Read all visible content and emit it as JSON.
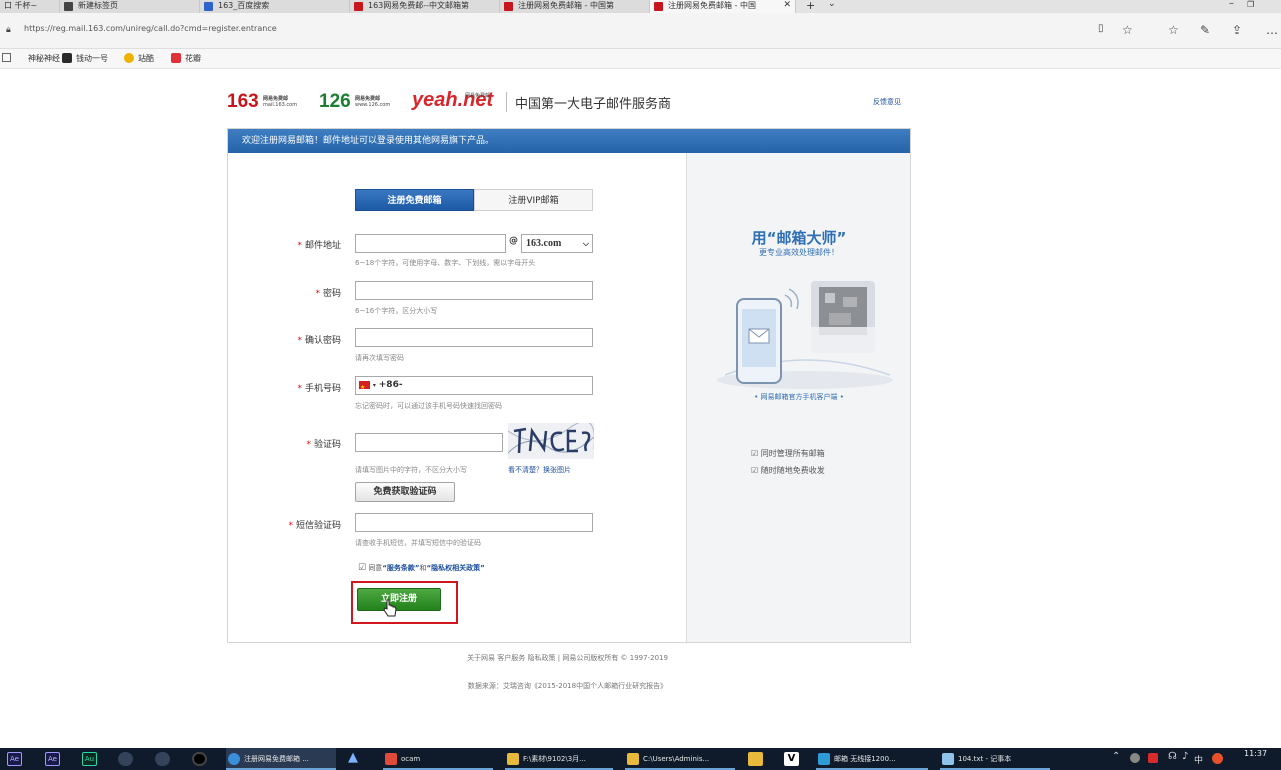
{
  "browser": {
    "tabs": [
      {
        "label": "口 千杯~",
        "active": false
      },
      {
        "label": "新建标签页",
        "active": false
      },
      {
        "label": "163_百度搜索",
        "active": false
      },
      {
        "label": "163网易免费邮--中文邮箱第",
        "active": false
      },
      {
        "label": "注册网易免费邮箱 - 中国第",
        "active": false
      },
      {
        "label": "注册网易免费邮箱 - 中国",
        "active": true
      }
    ],
    "url": "https://reg.mail.163.com/unireg/call.do?cmd=register.entrance",
    "bookmarks": [
      "神秘神经",
      "钱动一号",
      "站酷",
      "花瓣"
    ]
  },
  "header": {
    "logo_163": "163",
    "logo_163_sub_top": "网易免费邮",
    "logo_163_sub_bottom": "mail.163.com",
    "logo_126": "126",
    "logo_126_sub_top": "网易免费邮",
    "logo_126_sub_bottom": "www.126.com",
    "logo_yeah": "yeah.net",
    "logo_yeah_sub": "网易免费邮",
    "slogan": "中国第一大电子邮件服务商",
    "feedback_link": "反馈意见"
  },
  "banner": "欢迎注册网易邮箱！邮件地址可以登录使用其他网易旗下产品。",
  "form": {
    "tab_free": "注册免费邮箱",
    "tab_vip": "注册VIP邮箱",
    "email_label": "邮件地址",
    "email_at": "@",
    "email_domain": "163.com",
    "email_hint": "6~18个字符，可使用字母、数字、下划线，需以字母开头",
    "password_label": "密码",
    "password_hint": "6~16个字符，区分大小写",
    "confirm_label": "确认密码",
    "confirm_hint": "请再次填写密码",
    "phone_label": "手机号码",
    "phone_prefix": "+86-",
    "phone_hint": "忘记密码时，可以通过该手机号码快速找回密码",
    "captcha_label": "验证码",
    "captcha_hint": "请填写图片中的字符，不区分大小写",
    "captcha_unclear": "看不清楚？换张图片",
    "sms_button": "免费获取验证码",
    "sms_label": "短信验证码",
    "sms_hint": "请查收手机短信，并填写短信中的验证码",
    "agree_prefix": "同意",
    "agree_terms": "“服务条款”",
    "agree_and": "和",
    "agree_privacy": "“隐私权相关政策”",
    "submit": "立即注册"
  },
  "promo": {
    "title": "用“邮箱大师”",
    "subtitle": "更专业高效处理邮件！",
    "caption": "• 网易邮箱官方手机客户端 •",
    "features": [
      "同时管理所有邮箱",
      "随时随地免费收发"
    ]
  },
  "footer": {
    "links": "关于网易   客户服务   隐私政策   |   网易公司版权所有 © 1997-2019",
    "source": "数据来源：艾瑞咨询《2015-2018中国个人邮箱行业研究报告》"
  },
  "taskbar": {
    "items": [
      "注册网易免费邮箱 ...",
      "ocam",
      "F:\\素材\\9102\\3月...",
      "C:\\Users\\Adminis...",
      "邮箱 无线接1200...",
      "104.txt - 记事本"
    ],
    "time": "11:37",
    "ime": "中"
  }
}
